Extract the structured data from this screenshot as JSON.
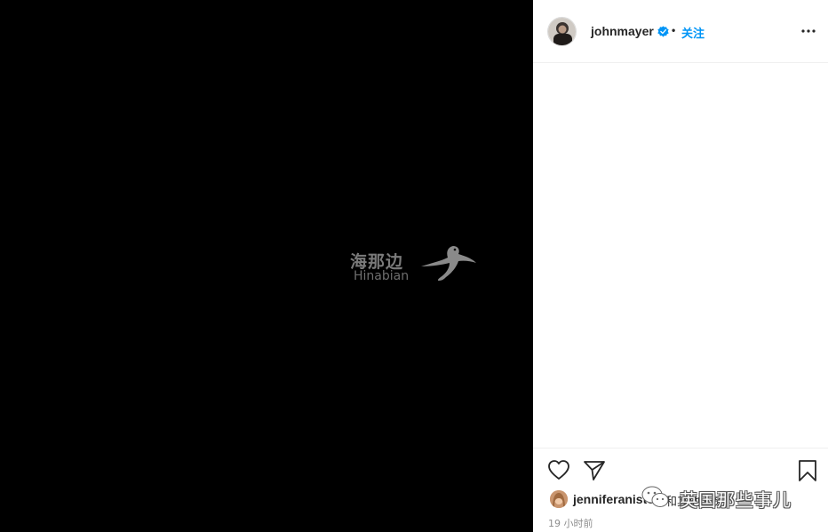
{
  "post": {
    "username": "johnmayer",
    "separator": "•",
    "follow_label": "关注",
    "verified": true
  },
  "watermark": {
    "chinese": "海那边",
    "latin": "Hinabian"
  },
  "likes": {
    "liker_name": "jenniferaniston",
    "rest_text": "和其他人赞了"
  },
  "overlay_watermark": {
    "text": "英国那些事儿"
  },
  "timestamp": "19 小时前",
  "icons": {
    "like": "heart-icon",
    "share": "paper-plane-icon",
    "save": "bookmark-icon",
    "more": "more-options-icon",
    "verified": "verified-badge-icon"
  },
  "colors": {
    "accent": "#0095f6",
    "media_background": "#000000",
    "text": "#262626",
    "secondary_text": "#8e8e8e"
  }
}
